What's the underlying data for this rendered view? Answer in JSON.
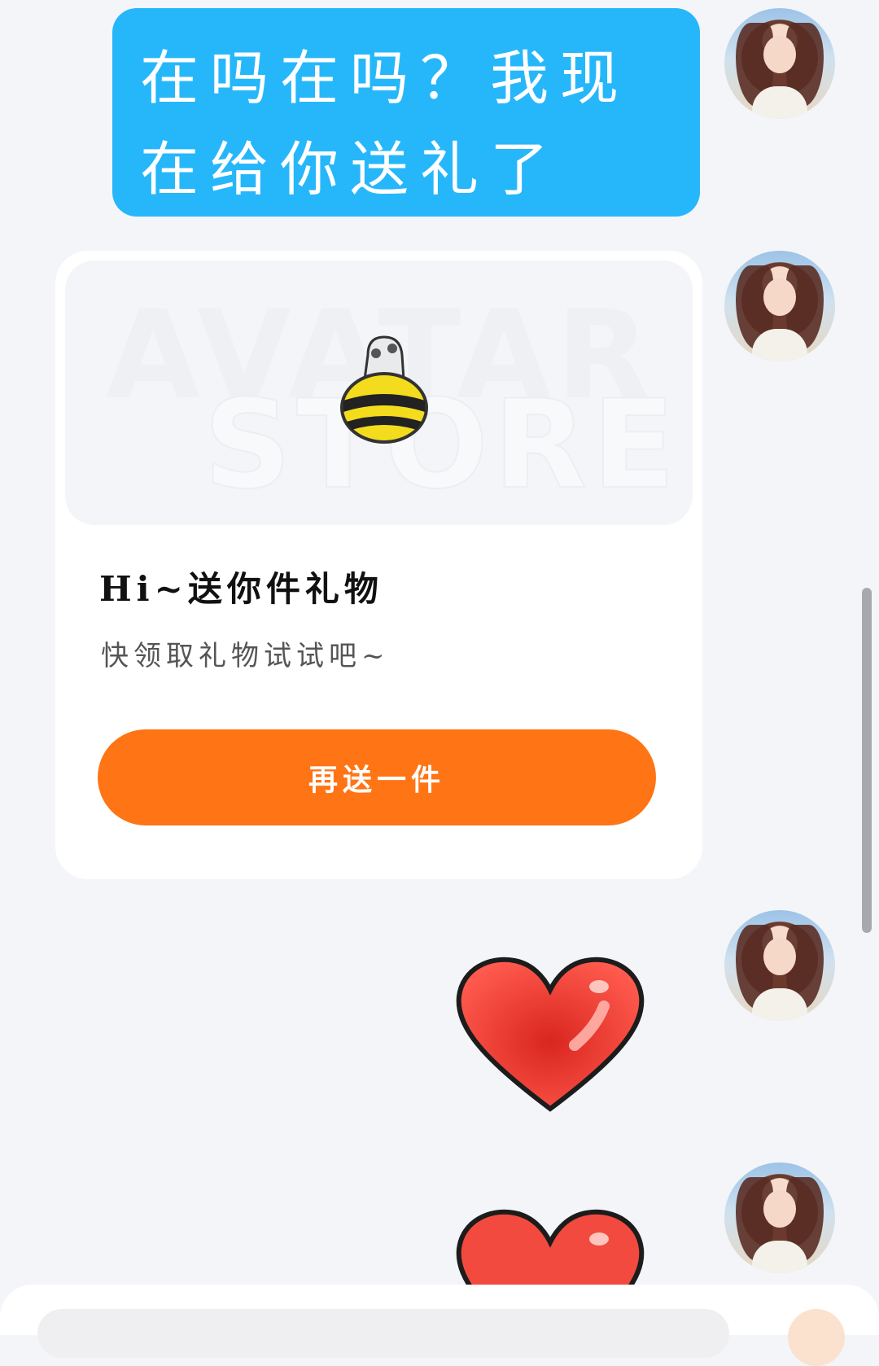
{
  "messages": {
    "text_bubble": "在吗在吗？我现在给你送礼了",
    "gift_card": {
      "watermark_line1": "AVATAR",
      "watermark_line2": "STORE",
      "title": "Hi~送你件礼物",
      "subtitle": "快领取礼物试试吧~",
      "button_label": "再送一件"
    }
  },
  "colors": {
    "bubble": "#26b7fa",
    "button": "#ff7414",
    "heart": "#e8322a",
    "background": "#f3f5f9"
  }
}
